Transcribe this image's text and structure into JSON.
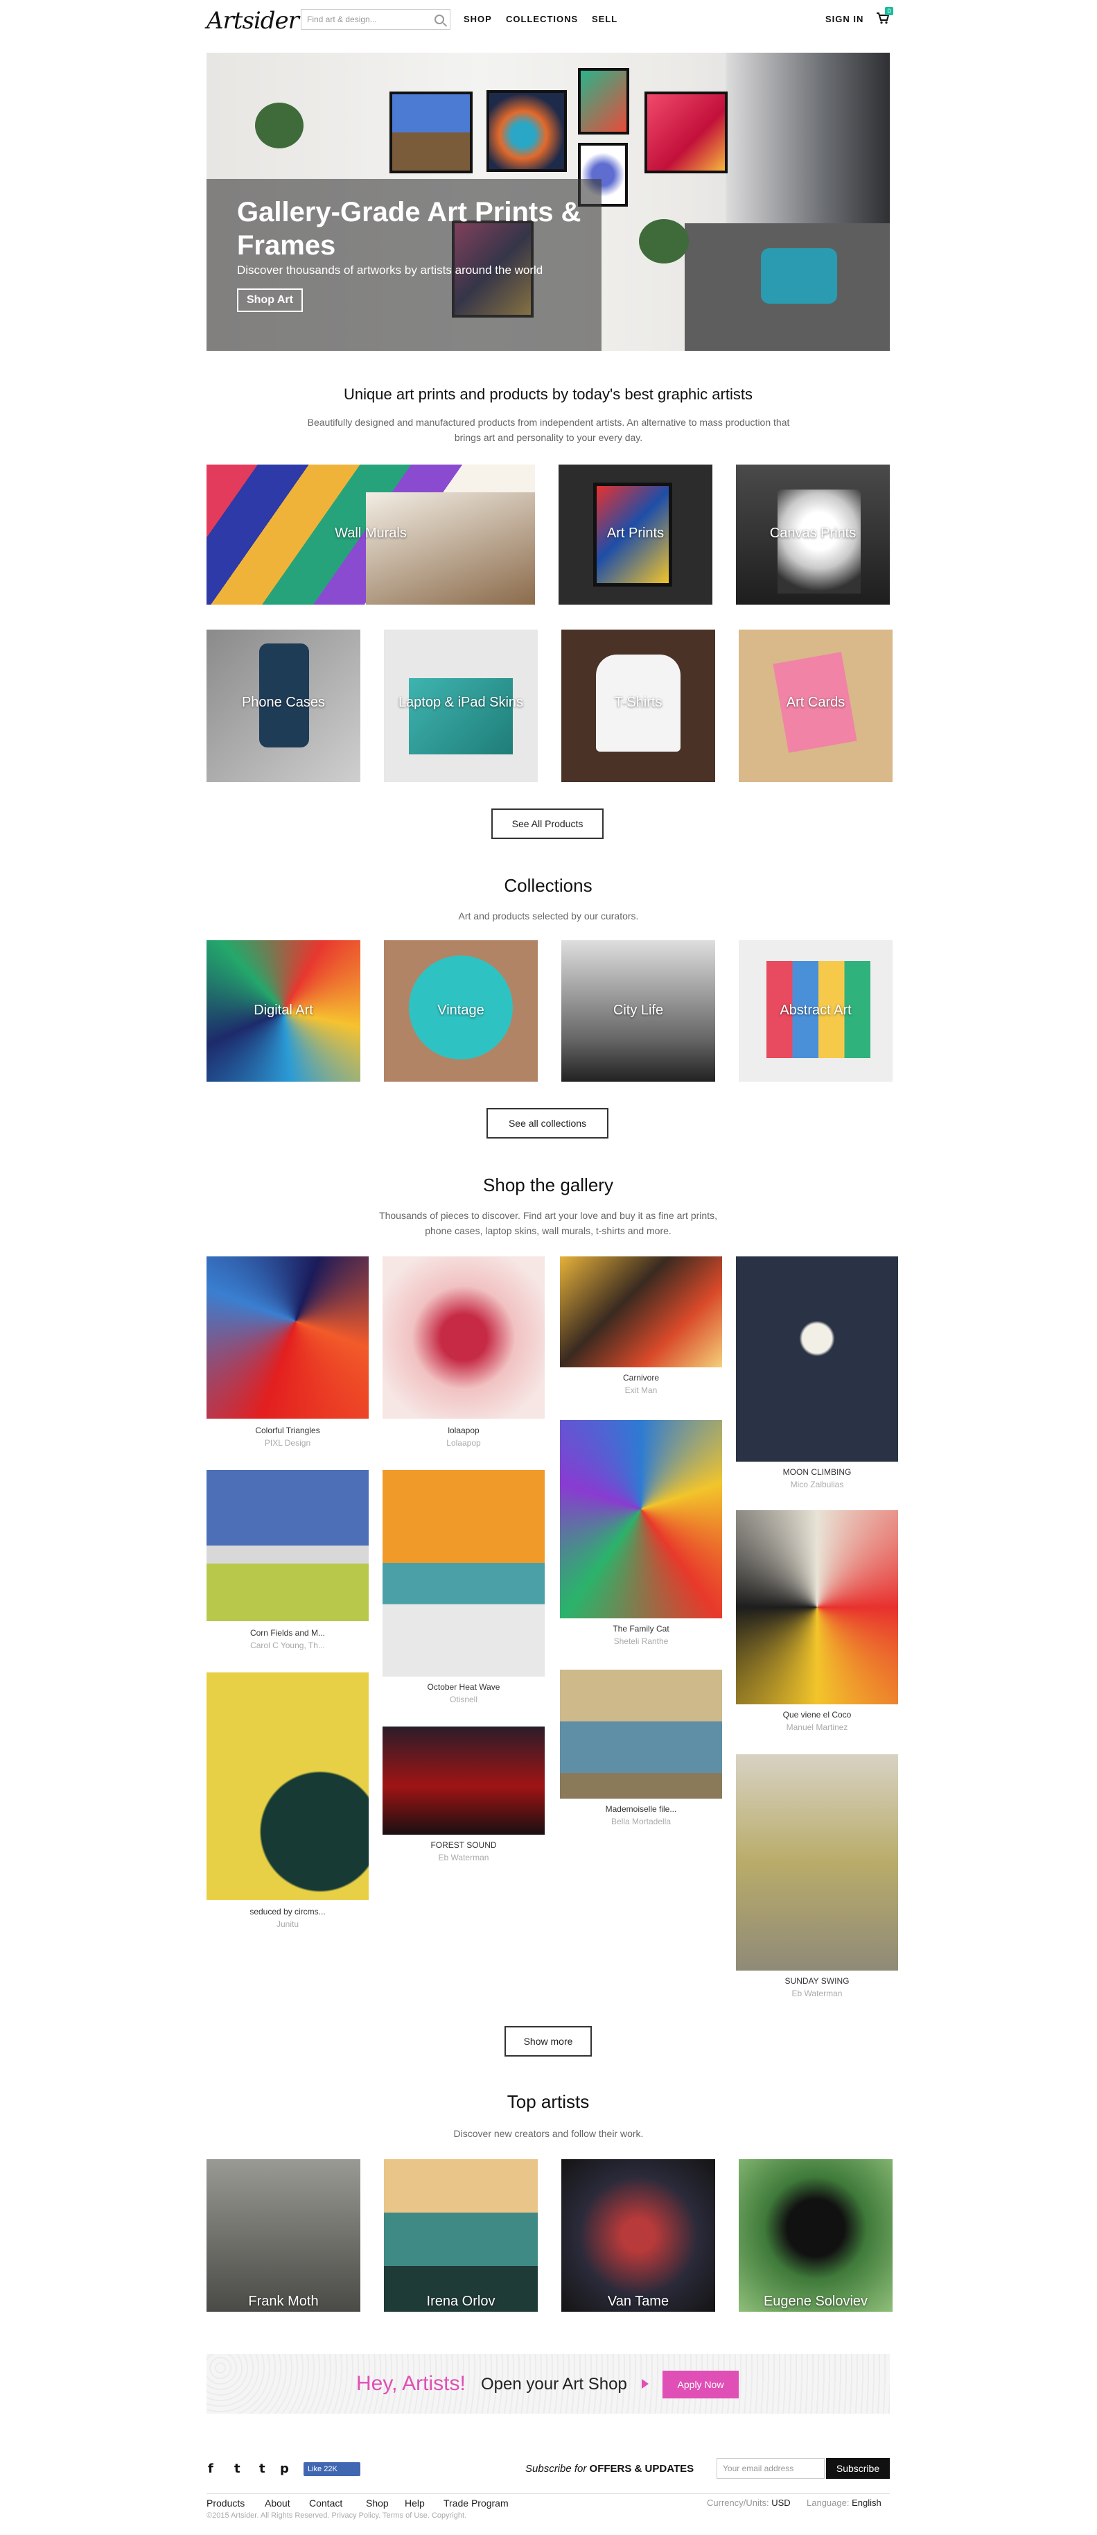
{
  "header": {
    "logo": "Artsider",
    "search_placeholder": "Find art & design...",
    "nav": [
      "SHOP",
      "COLLECTIONS",
      "SELL"
    ],
    "sign_in": "SIGN IN",
    "cart_count": "0"
  },
  "hero": {
    "title": "Gallery-Grade Art Prints & Frames",
    "subtitle": "Discover thousands of artworks by artists around the world",
    "button": "Shop Art"
  },
  "products": {
    "heading": "Unique art prints and products by today's best graphic artists",
    "description": "Beautifully designed and manufactured products from independent artists. An alternative to mass production that brings art and personality to your every day.",
    "tiles": [
      "Wall Murals",
      "Art Prints",
      "Canvas Prints",
      "Phone Cases",
      "Laptop & iPad Skins",
      "T-Shirts",
      "Art Cards"
    ],
    "button": "See All Products"
  },
  "collections": {
    "heading": "Collections",
    "description": "Art and products selected by our curators.",
    "tiles": [
      "Digital Art",
      "Vintage",
      "City Life",
      "Abstract Art"
    ],
    "button": "See all collections"
  },
  "gallery": {
    "heading": "Shop the gallery",
    "description": "Thousands of pieces to discover. Find art your love and buy it as fine art prints, phone cases, laptop skins, wall murals, t-shirts and more.",
    "items": [
      {
        "title": "Colorful Triangles",
        "artist": "PIXL Design"
      },
      {
        "title": "Corn Fields and M...",
        "artist": "Carol C Young, Th..."
      },
      {
        "title": "seduced by circms...",
        "artist": "Junitu"
      },
      {
        "title": "lolaapop",
        "artist": "Lolaapop"
      },
      {
        "title": "October Heat Wave",
        "artist": "Otisnell"
      },
      {
        "title": "FOREST SOUND",
        "artist": "Eb Waterman"
      },
      {
        "title": "Carnivore",
        "artist": "Exit Man"
      },
      {
        "title": "The Family Cat",
        "artist": "Sheteli Ranthe"
      },
      {
        "title": "Mademoiselle file...",
        "artist": "Bella Mortadella"
      },
      {
        "title": "MOON CLIMBING",
        "artist": "Mico Zalbulias"
      },
      {
        "title": "Que viene el Coco",
        "artist": "Manuel Martinez"
      },
      {
        "title": "SUNDAY SWING",
        "artist": "Eb Waterman"
      }
    ],
    "button": "Show more"
  },
  "artists": {
    "heading": "Top artists",
    "description": "Discover new creators and follow their work.",
    "names": [
      "Frank Moth",
      "Irena Orlov",
      "Van Tame",
      "Eugene Soloviev"
    ]
  },
  "banner": {
    "hey": "Hey, Artists!",
    "open": "Open your Art Shop",
    "apply": "Apply Now"
  },
  "footer": {
    "social": [
      "f",
      "t",
      "t",
      "p"
    ],
    "like": "Like 22K",
    "subscribe_prefix": "Subscribe for",
    "subscribe_bold": "OFFERS & UPDATES",
    "email_placeholder": "Your email address",
    "subscribe_button": "Subscribe",
    "links": [
      "Products",
      "About",
      "Contact",
      "Shop",
      "Help",
      "Trade Program"
    ],
    "copyright": "©2015 Artsider. All Rights Reserved. Privacy Policy. Terms of Use. Copyright.",
    "currency_label": "Currency/Units:",
    "currency_value": "USD",
    "language_label": "Language:",
    "language_value": "English"
  },
  "colors": {
    "accent": "#e04fb5",
    "cart": "#1abc9c"
  }
}
